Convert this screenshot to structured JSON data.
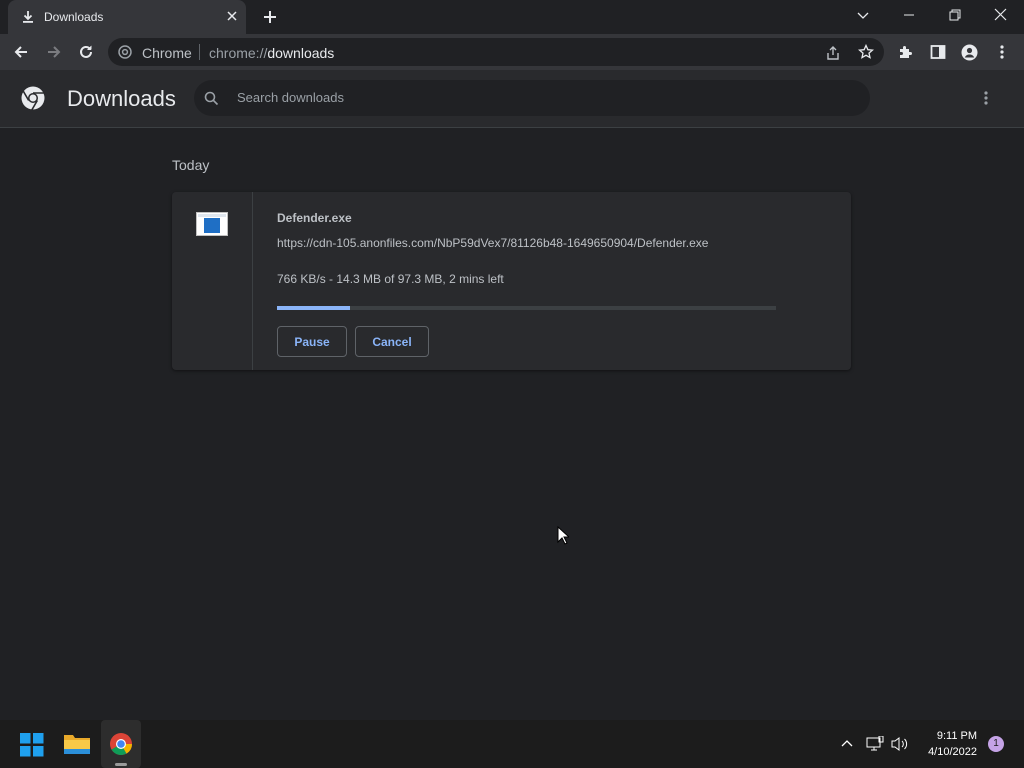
{
  "tab": {
    "title": "Downloads",
    "icon": "download-icon"
  },
  "omnibox": {
    "site_name": "Chrome",
    "url_scheme": "chrome://",
    "url_path": "downloads"
  },
  "header": {
    "title": "Downloads",
    "search_placeholder": "Search downloads"
  },
  "downloads": {
    "section_label": "Today",
    "items": [
      {
        "filename": "Defender.exe",
        "url": "https://cdn-105.anonfiles.com/NbP59dVex7/81126b48-1649650904/Defender.exe",
        "status": "766 KB/s - 14.3 MB of 97.3 MB, 2 mins left",
        "progress": 0.147,
        "pause_label": "Pause",
        "cancel_label": "Cancel"
      }
    ]
  },
  "taskbar": {
    "apps": [
      "windows-start-icon",
      "file-explorer-icon",
      "chrome-icon"
    ],
    "time": "9:11 PM",
    "date": "4/10/2022",
    "notification_count": "1"
  },
  "colors": {
    "accent": "#8ab4f8",
    "background": "#202124",
    "surface": "#292a2d"
  }
}
